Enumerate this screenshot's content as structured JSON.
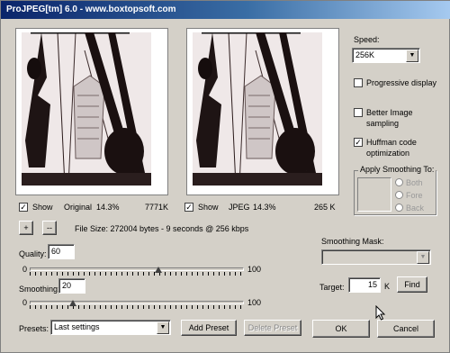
{
  "window": {
    "title": "ProJPEG[tm] 6.0 - www.boxtopsoft.com"
  },
  "original": {
    "show_label": "Show",
    "show_checked": true,
    "label": "Original",
    "percent": "14.3%",
    "size": "7771K"
  },
  "jpeg": {
    "show_label": "Show",
    "show_checked": true,
    "label": "JPEG",
    "percent": "14.3%",
    "size": "265 K"
  },
  "zoom": {
    "in_label": "+",
    "out_label": "--"
  },
  "file_size": {
    "text": "File Size:  272004 bytes - 9 seconds @ 256 kbps"
  },
  "speed": {
    "label": "Speed:",
    "value": "256K"
  },
  "options": {
    "progressive": {
      "label": "Progressive display",
      "checked": false
    },
    "better_sampling": {
      "label": "Better Image sampling",
      "checked": false
    },
    "huffman": {
      "label": "Huffman code optimization",
      "checked": true
    }
  },
  "smoothing_group": {
    "title": "Apply Smoothing To:",
    "both": "Both",
    "fore": "Fore",
    "back": "Back"
  },
  "quality": {
    "label": "Quality:",
    "value": "60",
    "min": "0",
    "max": "100",
    "level": 0.6
  },
  "smoothing": {
    "label": "Smoothing:",
    "value": "20",
    "min": "0",
    "max": "100",
    "level": 0.2
  },
  "smoothing_mask": {
    "label": "Smoothing Mask:",
    "value": ""
  },
  "target": {
    "label": "Target:",
    "value": "15",
    "unit": "K",
    "find_label": "Find"
  },
  "presets": {
    "label": "Presets:",
    "value": "Last settings",
    "add_label": "Add Preset",
    "delete_label": "Delete Preset"
  },
  "dialog": {
    "ok_label": "OK",
    "cancel_label": "Cancel"
  }
}
